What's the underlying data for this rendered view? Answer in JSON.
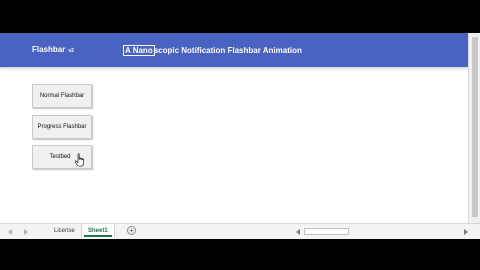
{
  "banner": {
    "app_name": "Flashbar",
    "app_version": "v2",
    "headline_selected": "A Nano",
    "headline_rest": "scopic Notification Flashbar Animation",
    "color": "#4a63c2"
  },
  "buttons": {
    "normal_label": "Normal Flashbar",
    "progress_label": "Progress Flashbar",
    "testbed_label": "Testbed"
  },
  "cursor": {
    "icon": "hand-pointer-icon"
  },
  "sheet_tabs": [
    {
      "label": "License",
      "active": false
    },
    {
      "label": "Sheet1",
      "active": true
    }
  ],
  "icons": {
    "add_sheet": "+",
    "tab_nav_left": "tab-scroll-left-icon",
    "tab_nav_right": "tab-scroll-right-icon",
    "hscroll_left": "scroll-left-icon",
    "hscroll_right": "scroll-right-icon",
    "vscroll_down": "scroll-down-icon"
  }
}
